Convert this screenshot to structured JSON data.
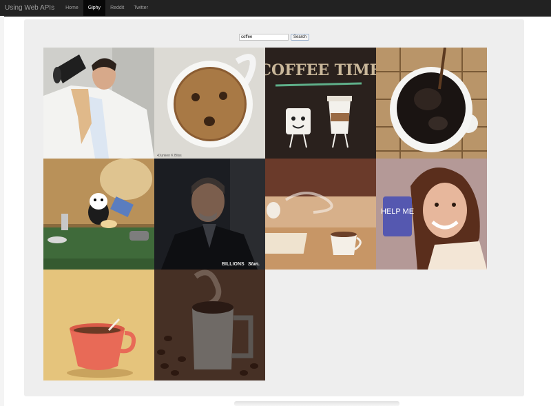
{
  "navbar": {
    "brand": "Using Web APIs",
    "items": [
      {
        "label": "Home",
        "active": false
      },
      {
        "label": "Giphy",
        "active": true
      },
      {
        "label": "Reddit",
        "active": false
      },
      {
        "label": "Twitter",
        "active": false
      }
    ]
  },
  "search": {
    "value": "coffee",
    "button_label": "Search"
  },
  "gifs": [
    {
      "subject": "man in bathrobe drinking from huge mug"
    },
    {
      "subject": "coffee with face in foam",
      "watermark": "•Dunken K Bliss"
    },
    {
      "subject": "coffee time cartoon cups",
      "text": "COFFEE TIME"
    },
    {
      "subject": "black coffee stirred in white cup"
    },
    {
      "subject": "cartoon cat pouring coffee"
    },
    {
      "subject": "man in dark suit",
      "watermark": "BILLIONS",
      "watermark2": "Stan."
    },
    {
      "subject": "steaming coffee cup by window"
    },
    {
      "subject": "woman holding mug",
      "text": "HELP ME"
    },
    {
      "subject": "red cup illustration"
    },
    {
      "subject": "steaming metal mug with coffee beans"
    }
  ],
  "colors": {
    "navbar_bg": "#222222",
    "well_bg": "#eeeeee"
  }
}
